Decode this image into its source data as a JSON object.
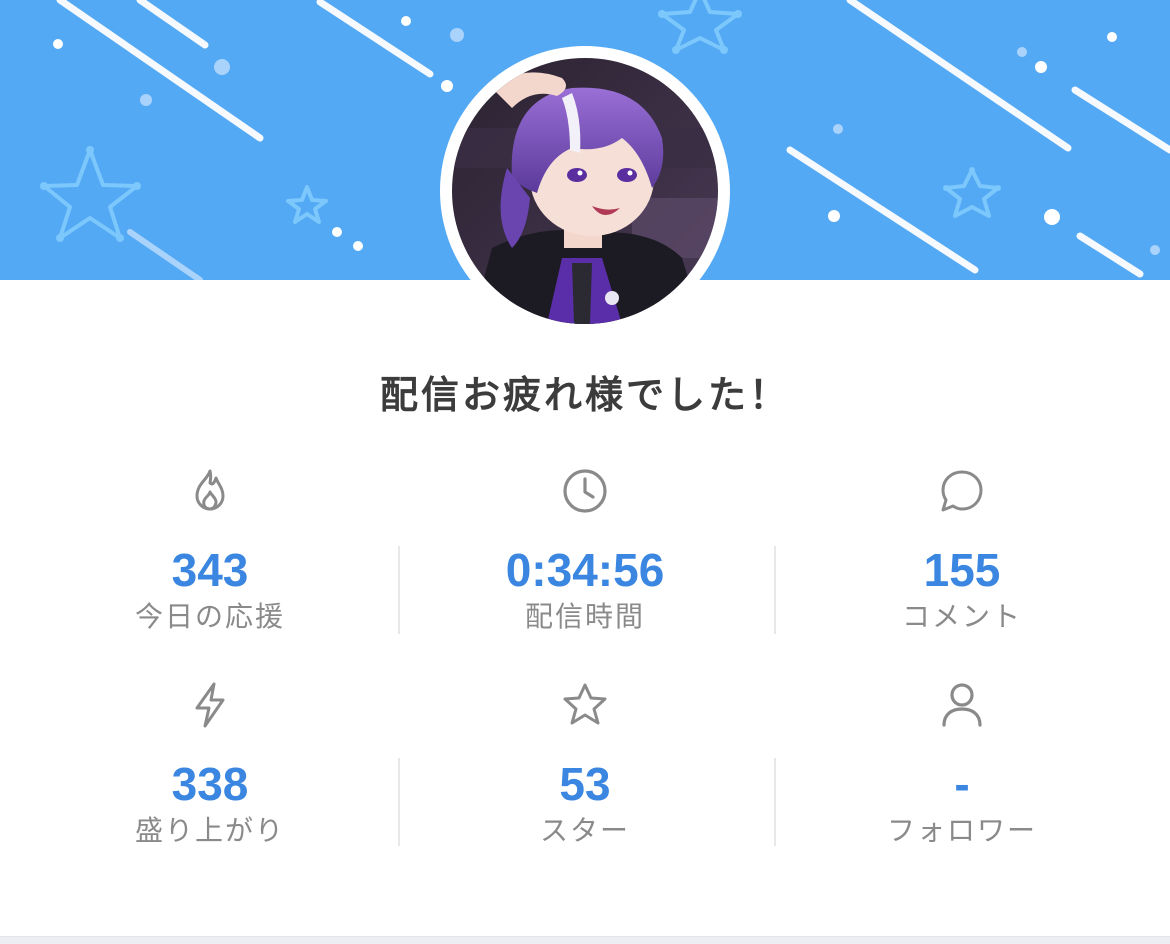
{
  "summary": {
    "title": "配信お疲れ様でした！"
  },
  "stats": [
    {
      "icon": "flame-icon",
      "value": "343",
      "label": "今日の応援"
    },
    {
      "icon": "clock-icon",
      "value": "0:34:56",
      "label": "配信時間"
    },
    {
      "icon": "chat-bubble-icon",
      "value": "155",
      "label": "コメント"
    },
    {
      "icon": "lightning-icon",
      "value": "338",
      "label": "盛り上がり"
    },
    {
      "icon": "star-icon",
      "value": "53",
      "label": "スター"
    },
    {
      "icon": "person-icon",
      "value": "-",
      "label": "フォロワー"
    }
  ],
  "colors": {
    "header": "#54a9f4",
    "value": "#3a86e0",
    "label": "#8a8a8a",
    "icon": "#8a8a8a",
    "title": "#3c3c3c"
  }
}
